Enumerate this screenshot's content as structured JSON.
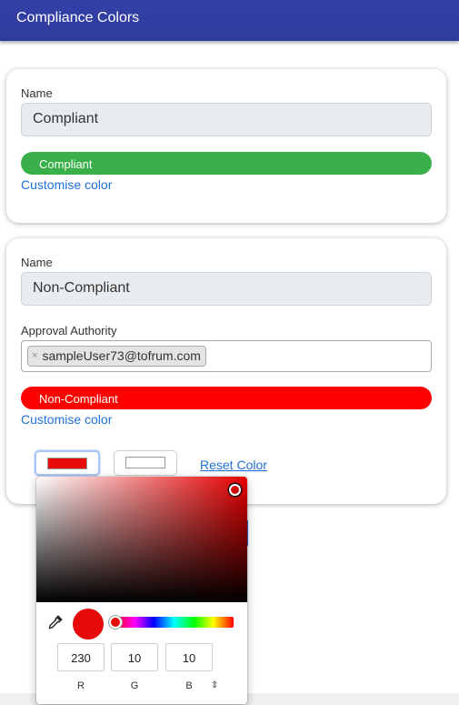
{
  "header": {
    "title": "Compliance Colors"
  },
  "cards": [
    {
      "name_label": "Name",
      "name_value": "Compliant",
      "badge": "Compliant",
      "badge_color": "#3ab04a",
      "customise_link": "Customise color"
    },
    {
      "name_label": "Name",
      "name_value": "Non-Compliant",
      "approval_label": "Approval Authority",
      "approval_tags": [
        "sampleUser73@tofrum.com"
      ],
      "tag_remove": "×",
      "badge": "Non-Compliant",
      "badge_color": "#ff0000",
      "customise_link": "Customise color",
      "reset_link": "Reset Color"
    }
  ],
  "color_picker": {
    "hue_color": "#e60000",
    "selected_color": "#e60a0a",
    "r": "230",
    "g": "10",
    "b": "10",
    "labels": {
      "r": "R",
      "g": "G",
      "b": "B"
    },
    "mode_toggle": "⇕"
  }
}
